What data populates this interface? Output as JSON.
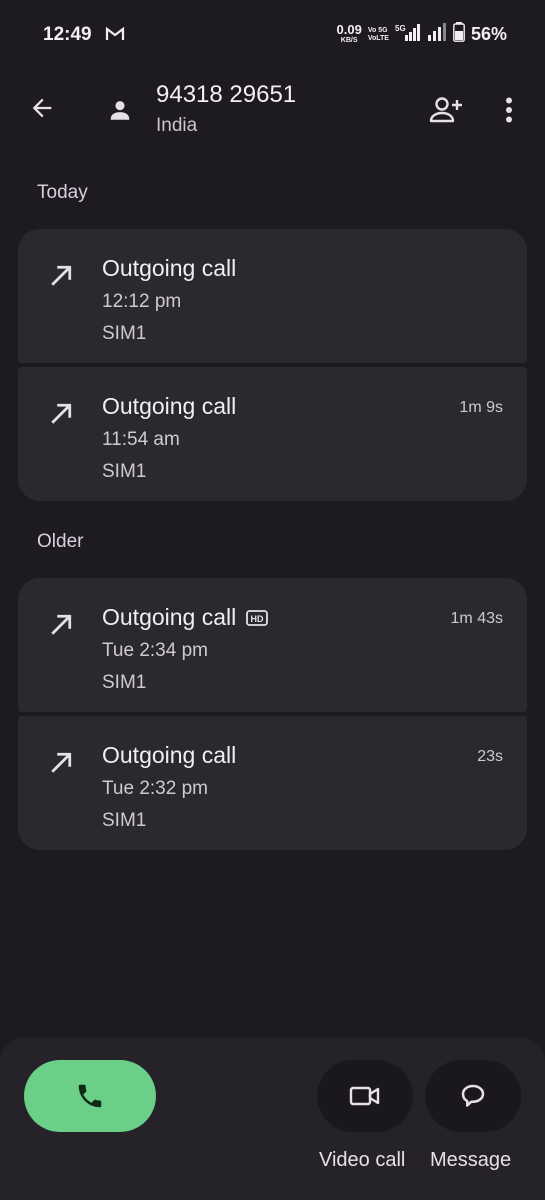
{
  "status_bar": {
    "time": "12:49",
    "net_speed_value": "0.09",
    "net_speed_unit": "KB/S",
    "volte_top": "Vo 5G",
    "volte_bottom": "VoLTE",
    "battery_percent": "56%"
  },
  "header": {
    "number": "94318 29651",
    "region": "India"
  },
  "sections": {
    "today": {
      "label": "Today",
      "calls": [
        {
          "type": "Outgoing call",
          "time": "12:12 pm",
          "sim": "SIM1",
          "duration": ""
        },
        {
          "type": "Outgoing call",
          "time": "11:54 am",
          "sim": "SIM1",
          "duration": "1m 9s"
        }
      ]
    },
    "older": {
      "label": "Older",
      "calls": [
        {
          "type": "Outgoing call",
          "time": "Tue 2:34 pm",
          "sim": "SIM1",
          "duration": "1m 43s",
          "hd": "HD"
        },
        {
          "type": "Outgoing call",
          "time": "Tue 2:32 pm",
          "sim": "SIM1",
          "duration": "23s"
        }
      ]
    }
  },
  "actions": {
    "video_call_label": "Video call",
    "message_label": "Message"
  },
  "colors": {
    "background": "#1e1b20",
    "card": "#2b2930",
    "call_button": "#6ccf87"
  }
}
